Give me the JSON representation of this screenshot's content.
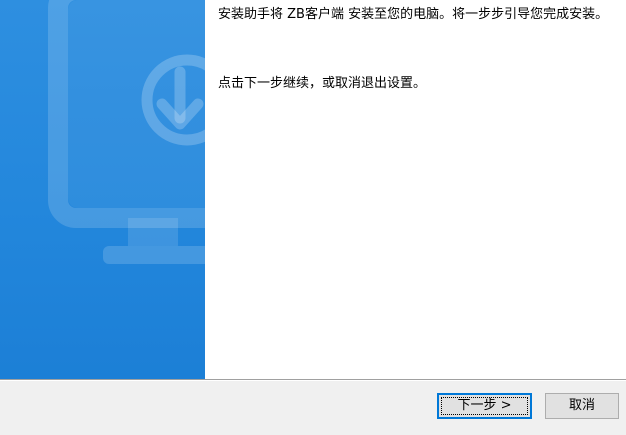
{
  "content": {
    "intro_text": "安装助手将 ZB客户端 安装至您的电脑。将一步步引导您完成安装。",
    "instruction_text": "点击下一步继续，或取消退出设置。"
  },
  "buttons": {
    "next_label": "下一步 >",
    "cancel_label": "取消"
  },
  "colors": {
    "banner_blue": "#2387dc",
    "accent_focus": "#0078d7"
  },
  "icons": {
    "banner": "monitor-download-icon"
  }
}
